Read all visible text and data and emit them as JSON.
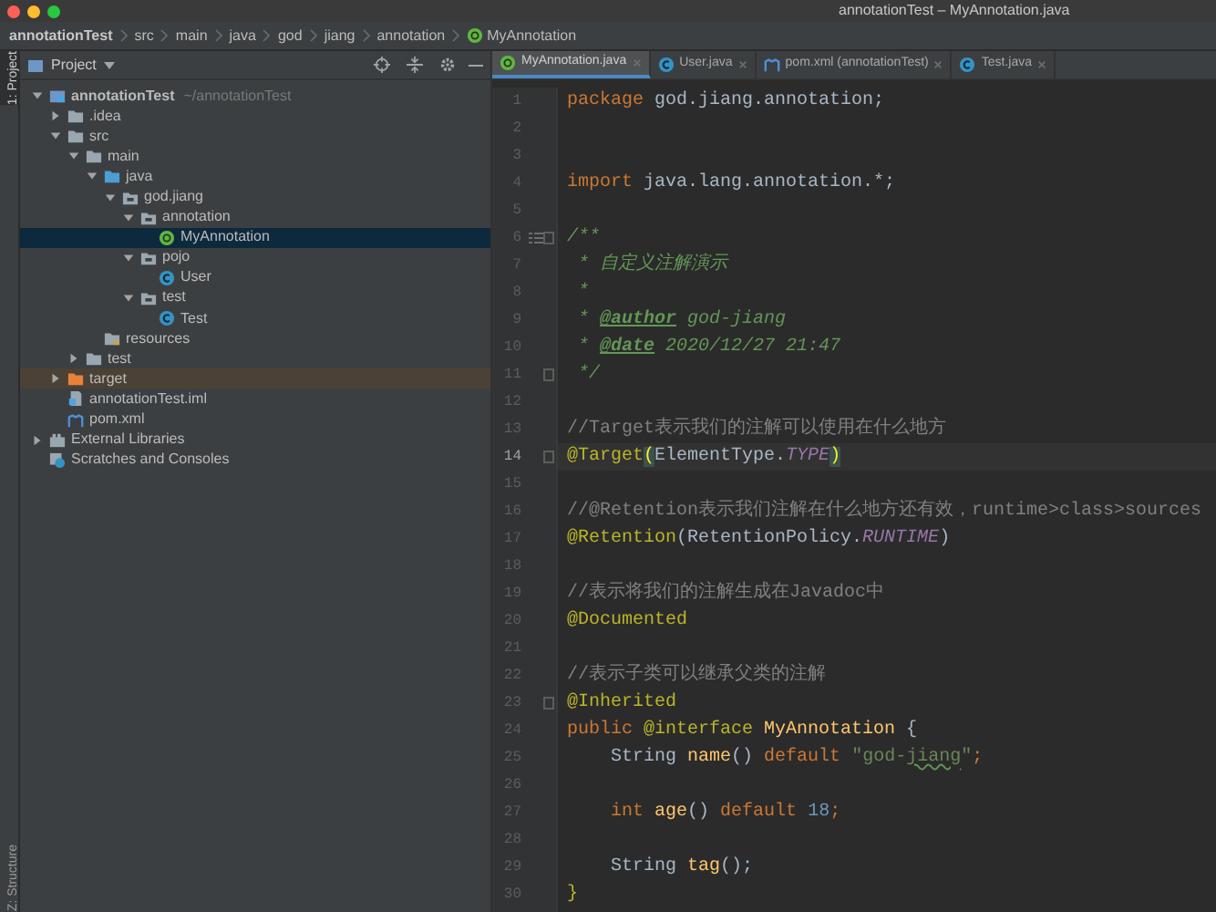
{
  "window": {
    "title": "annotationTest – MyAnnotation.java"
  },
  "breadcrumbs": [
    {
      "label": "annotationTest",
      "kind": "module"
    },
    {
      "label": "src",
      "kind": "folder"
    },
    {
      "label": "main",
      "kind": "folder"
    },
    {
      "label": "java",
      "kind": "folder"
    },
    {
      "label": "god",
      "kind": "folder"
    },
    {
      "label": "jiang",
      "kind": "folder"
    },
    {
      "label": "annotation",
      "kind": "folder"
    },
    {
      "label": "MyAnnotation",
      "kind": "annotation"
    }
  ],
  "side_strip": [
    {
      "label": "1: Project",
      "selected": true
    },
    {
      "label": "Z: Structure",
      "selected": false
    }
  ],
  "project_panel": {
    "title": "Project",
    "tree": [
      {
        "label": "annotationTest",
        "hint": "~/annotationTest",
        "kind": "module",
        "expanded": true,
        "selected": false,
        "excluded": false,
        "children": [
          {
            "label": ".idea",
            "kind": "folder",
            "expanded": false,
            "selected": false,
            "excluded": false
          },
          {
            "label": "src",
            "kind": "folder",
            "expanded": true,
            "selected": false,
            "excluded": false,
            "children": [
              {
                "label": "main",
                "kind": "folder",
                "expanded": true,
                "selected": false,
                "excluded": false,
                "children": [
                  {
                    "label": "java",
                    "kind": "source-folder",
                    "expanded": true,
                    "selected": false,
                    "excluded": false,
                    "children": [
                      {
                        "label": "god.jiang",
                        "kind": "package",
                        "expanded": true,
                        "selected": false,
                        "excluded": false,
                        "children": [
                          {
                            "label": "annotation",
                            "kind": "package",
                            "expanded": true,
                            "selected": false,
                            "excluded": false,
                            "children": [
                              {
                                "label": "MyAnnotation",
                                "kind": "annotation",
                                "selected": true,
                                "excluded": false
                              }
                            ]
                          },
                          {
                            "label": "pojo",
                            "kind": "package",
                            "expanded": true,
                            "selected": false,
                            "excluded": false,
                            "children": [
                              {
                                "label": "User",
                                "kind": "class",
                                "selected": false,
                                "excluded": false
                              }
                            ]
                          },
                          {
                            "label": "test",
                            "kind": "package",
                            "expanded": true,
                            "selected": false,
                            "excluded": false,
                            "children": [
                              {
                                "label": "Test",
                                "kind": "class",
                                "selected": false,
                                "excluded": false
                              }
                            ]
                          }
                        ]
                      }
                    ]
                  },
                  {
                    "label": "resources",
                    "kind": "resources",
                    "selected": false,
                    "excluded": false
                  }
                ]
              },
              {
                "label": "test",
                "kind": "folder",
                "expanded": false,
                "selected": false,
                "excluded": false
              }
            ]
          },
          {
            "label": "target",
            "kind": "excluded-folder",
            "expanded": false,
            "selected": false,
            "excluded": true
          },
          {
            "label": "annotationTest.iml",
            "kind": "iml",
            "selected": false,
            "excluded": false
          },
          {
            "label": "pom.xml",
            "kind": "maven",
            "selected": false,
            "excluded": false
          }
        ]
      },
      {
        "label": "External Libraries",
        "kind": "library",
        "expanded": false,
        "selected": false,
        "excluded": false
      },
      {
        "label": "Scratches and Consoles",
        "kind": "scratches",
        "selected": false,
        "excluded": false
      }
    ]
  },
  "tabs": [
    {
      "label": "MyAnnotation.java",
      "kind": "annotation",
      "selected": true
    },
    {
      "label": "User.java",
      "kind": "class",
      "selected": false
    },
    {
      "label": "pom.xml (annotationTest)",
      "kind": "maven",
      "selected": false
    },
    {
      "label": "Test.java",
      "kind": "class",
      "selected": false
    }
  ],
  "code": [
    {
      "number": "1",
      "current": false,
      "fold": false,
      "tokens": [
        {
          "kind": "keyword",
          "text": "package"
        },
        {
          "kind": "plain",
          "text": " god.jiang.annotation;"
        }
      ]
    },
    {
      "number": "2",
      "current": false,
      "fold": false
    },
    {
      "number": "3",
      "current": false,
      "fold": false
    },
    {
      "number": "4",
      "current": false,
      "fold": false,
      "tokens": [
        {
          "kind": "keyword",
          "text": "import"
        },
        {
          "kind": "plain",
          "text": " java.lang.annotation.*;"
        }
      ]
    },
    {
      "number": "5",
      "current": false,
      "fold": false
    },
    {
      "number": "6",
      "current": false,
      "fold": true,
      "doc_toggle": true,
      "tokens": [
        {
          "kind": "doc",
          "text": "/**"
        }
      ]
    },
    {
      "number": "7",
      "current": false,
      "fold": false,
      "tokens": [
        {
          "kind": "doc",
          "text": " * 自定义注解演示"
        }
      ]
    },
    {
      "number": "8",
      "current": false,
      "fold": false,
      "tokens": [
        {
          "kind": "doc",
          "text": " *"
        }
      ]
    },
    {
      "number": "9",
      "current": false,
      "fold": false,
      "tokens": [
        {
          "kind": "doc",
          "text": " * "
        },
        {
          "kind": "doc-tag",
          "text": "@author"
        },
        {
          "kind": "doc-value",
          "text": " god-jiang"
        }
      ]
    },
    {
      "number": "10",
      "current": false,
      "fold": false,
      "tokens": [
        {
          "kind": "doc",
          "text": " * "
        },
        {
          "kind": "doc-tag",
          "text": "@date"
        },
        {
          "kind": "doc-value",
          "text": " 2020/12/27 21:47"
        }
      ]
    },
    {
      "number": "11",
      "current": false,
      "fold": true,
      "tokens": [
        {
          "kind": "doc",
          "text": " */"
        }
      ]
    },
    {
      "number": "12",
      "current": false,
      "fold": false
    },
    {
      "number": "13",
      "current": false,
      "fold": false,
      "tokens": [
        {
          "kind": "comment",
          "text": "//Target表示我们的注解可以使用在什么地方"
        }
      ]
    },
    {
      "number": "14",
      "current": true,
      "fold": true,
      "tokens": [
        {
          "kind": "annotation",
          "text": "@Target"
        },
        {
          "kind": "brace-match",
          "text": "("
        },
        {
          "kind": "plain",
          "text": "ElementType."
        },
        {
          "kind": "constant",
          "text": "TYPE"
        },
        {
          "kind": "brace-match",
          "text": ")"
        }
      ]
    },
    {
      "number": "15",
      "current": false,
      "fold": false
    },
    {
      "number": "16",
      "current": false,
      "fold": false,
      "tokens": [
        {
          "kind": "comment",
          "text": "//@Retention表示我们注解在什么地方还有效，runtime>class>sources"
        }
      ]
    },
    {
      "number": "17",
      "current": false,
      "fold": false,
      "tokens": [
        {
          "kind": "annotation",
          "text": "@Retention"
        },
        {
          "kind": "plain",
          "text": "(RetentionPolicy."
        },
        {
          "kind": "constant",
          "text": "RUNTIME"
        },
        {
          "kind": "plain",
          "text": ")"
        }
      ]
    },
    {
      "number": "18",
      "current": false,
      "fold": false
    },
    {
      "number": "19",
      "current": false,
      "fold": false,
      "tokens": [
        {
          "kind": "comment",
          "text": "//表示将我们的注解生成在Javadoc中"
        }
      ]
    },
    {
      "number": "20",
      "current": false,
      "fold": false,
      "tokens": [
        {
          "kind": "annotation",
          "text": "@Documented"
        }
      ]
    },
    {
      "number": "21",
      "current": false,
      "fold": false
    },
    {
      "number": "22",
      "current": false,
      "fold": false,
      "tokens": [
        {
          "kind": "comment",
          "text": "//表示子类可以继承父类的注解"
        }
      ]
    },
    {
      "number": "23",
      "current": false,
      "fold": true,
      "tokens": [
        {
          "kind": "annotation",
          "text": "@Inherited"
        }
      ]
    },
    {
      "number": "24",
      "current": false,
      "fold": false,
      "tokens": [
        {
          "kind": "keyword",
          "text": "public"
        },
        {
          "kind": "annotation",
          "text": " @interface"
        },
        {
          "kind": "method",
          "text": " MyAnnotation"
        },
        {
          "kind": "plain",
          "text": " {"
        }
      ]
    },
    {
      "number": "25",
      "current": false,
      "fold": false,
      "tokens": [
        {
          "kind": "plain",
          "text": "    String "
        },
        {
          "kind": "method",
          "text": "name"
        },
        {
          "kind": "plain",
          "text": "() "
        },
        {
          "kind": "keyword",
          "text": "default"
        },
        {
          "kind": "string",
          "text": " \"god-"
        },
        {
          "kind": "string-typo",
          "text": "jiang"
        },
        {
          "kind": "string",
          "text": "\""
        },
        {
          "kind": "keyword",
          "text": ";"
        }
      ]
    },
    {
      "number": "26",
      "current": false,
      "fold": false
    },
    {
      "number": "27",
      "current": false,
      "fold": false,
      "tokens": [
        {
          "kind": "keyword",
          "text": "    int"
        },
        {
          "kind": "method",
          "text": " age"
        },
        {
          "kind": "plain",
          "text": "() "
        },
        {
          "kind": "keyword",
          "text": "default"
        },
        {
          "kind": "number",
          "text": " 18"
        },
        {
          "kind": "keyword",
          "text": ";"
        }
      ]
    },
    {
      "number": "28",
      "current": false,
      "fold": false
    },
    {
      "number": "29",
      "current": false,
      "fold": false,
      "tokens": [
        {
          "kind": "plain",
          "text": "    String "
        },
        {
          "kind": "method",
          "text": "tag"
        },
        {
          "kind": "plain",
          "text": "();"
        }
      ]
    },
    {
      "number": "30",
      "current": false,
      "fold": false,
      "tokens": [
        {
          "kind": "annotation",
          "text": "}"
        }
      ]
    }
  ]
}
